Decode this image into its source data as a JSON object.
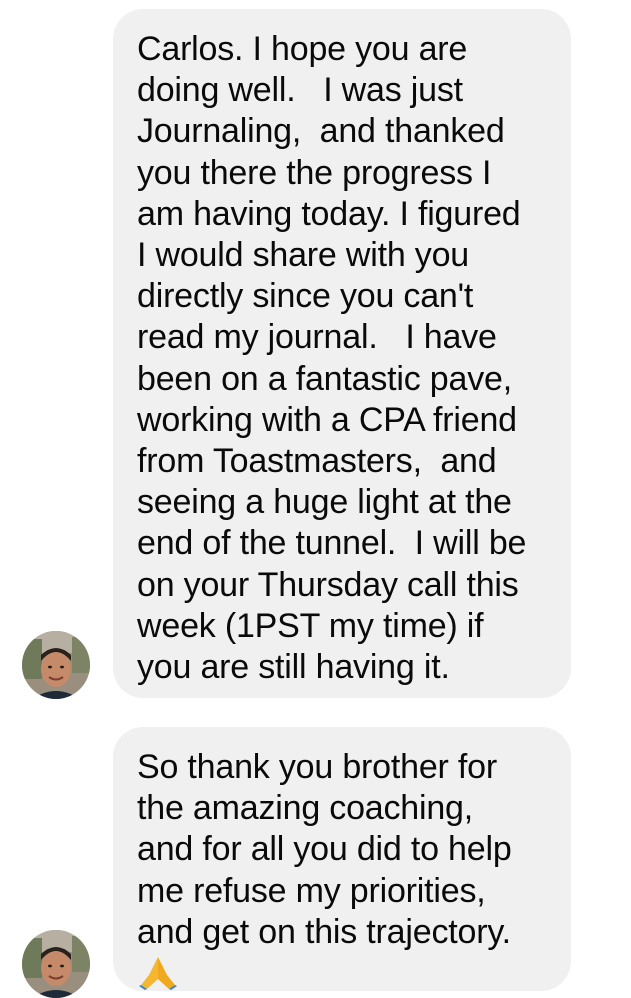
{
  "conversation": {
    "messages": [
      {
        "lines": [
          "Carlos. I hope you are",
          "doing well.   I was just",
          "Journaling,  and thanked",
          "you there the progress I",
          "am having today. I figured",
          "I would share with you",
          "directly since you can't",
          "read my journal.   I have",
          "been on a fantastic pave,",
          "working with a CPA friend",
          "from Toastmasters,  and",
          "seeing a huge light at the",
          "end of the tunnel.  I will be",
          "on your Thursday call this",
          "week (1PST my time) if",
          "you are still having it."
        ]
      },
      {
        "lines": [
          "So thank you brother for",
          "the amazing coaching,",
          "and for all you did to help",
          "me refuse my priorities,",
          "and get on this trajectory."
        ],
        "emoji": "🙏"
      }
    ],
    "emoji_icon": "folded-hands-icon",
    "colors": {
      "bubble_bg": "#f1f0f0",
      "text": "#0a0a0a",
      "page_bg": "#ffffff",
      "emoji": "#f5b731"
    }
  }
}
